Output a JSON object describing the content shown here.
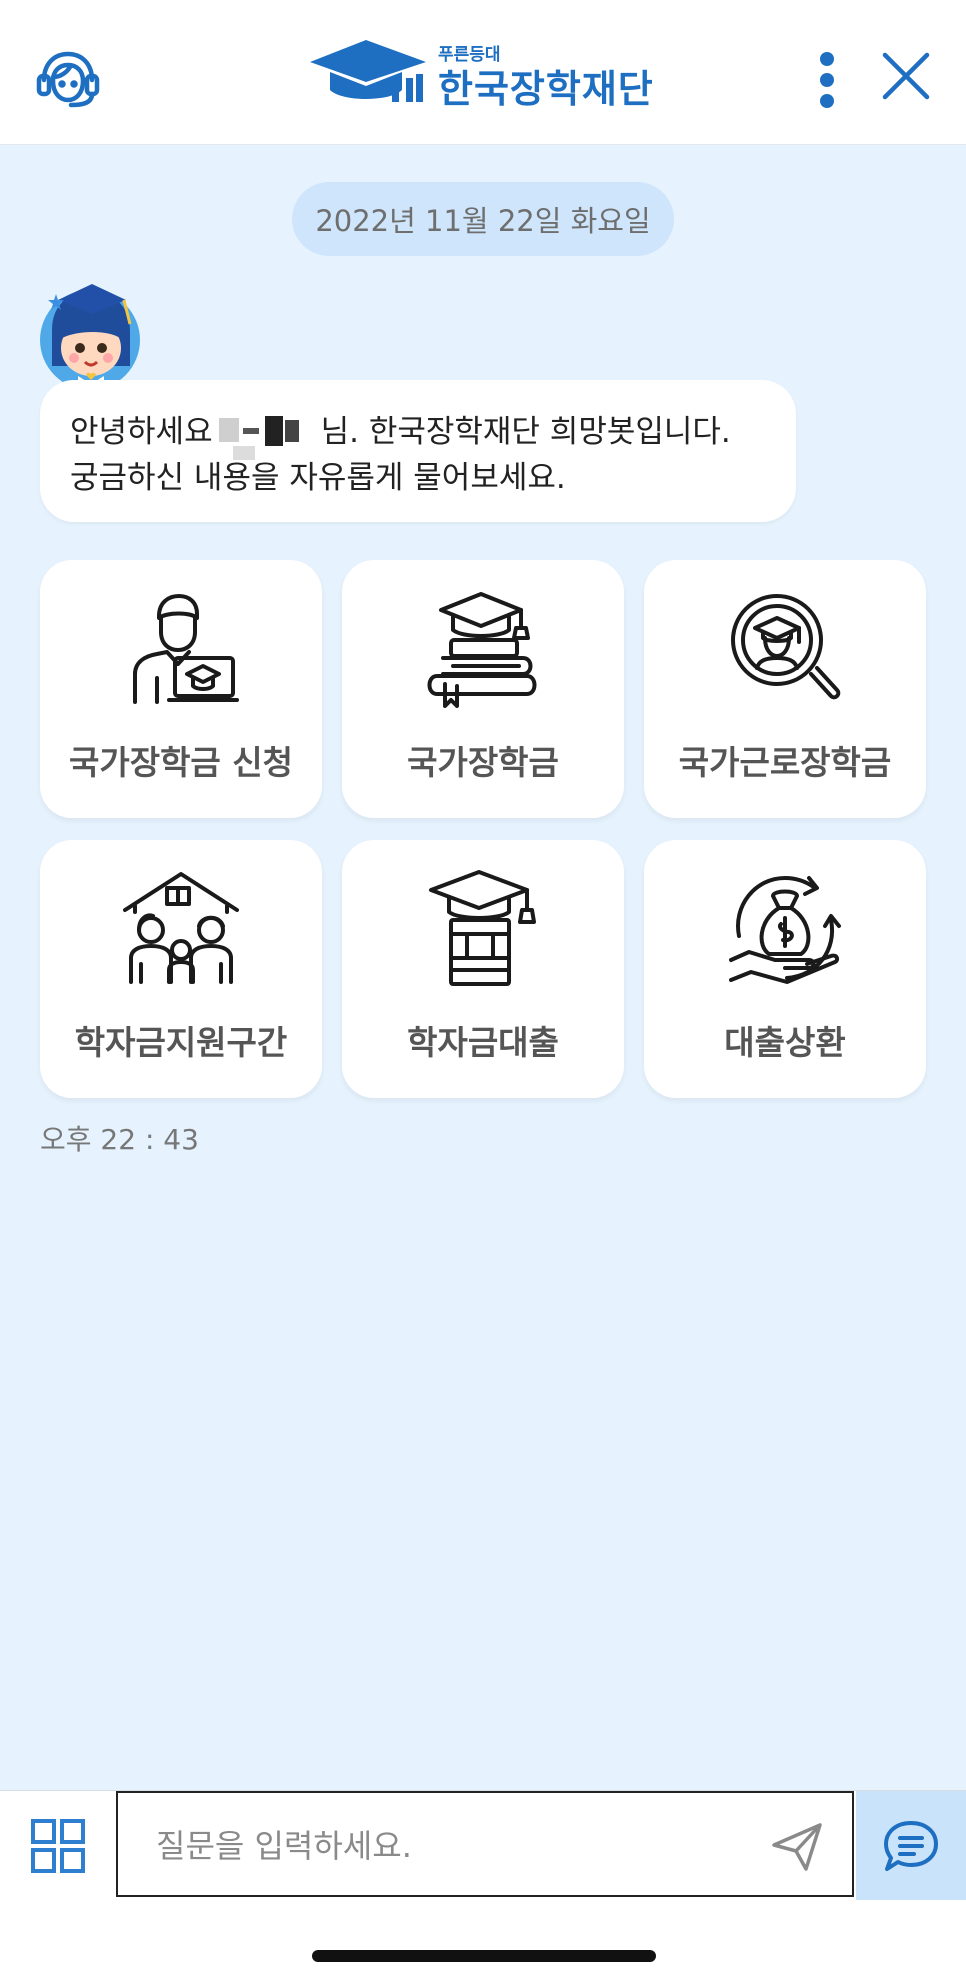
{
  "header": {
    "logo_sub": "푸른등대",
    "logo_main": "한국장학재단",
    "brand_color": "#1e6fc1",
    "left_icon": "headset-agent-icon",
    "more_icon": "more-vertical-icon",
    "close_icon": "close-icon"
  },
  "date_label": "2022년 11월 22일 화요일",
  "greeting": {
    "line1_a": "안녕하세요",
    "line1_b": "님. 한국장학재단 희망봇입니다.",
    "line2": "궁금하신 내용을 자유롭게 물어보세요."
  },
  "menu_tiles": [
    {
      "label": "국가장학금 신청",
      "icon": "student-laptop-icon"
    },
    {
      "label": "국가장학금",
      "icon": "books-graduation-cap-icon"
    },
    {
      "label": "국가근로장학금",
      "icon": "magnifier-graduate-icon"
    },
    {
      "label": "학자금지원구간",
      "icon": "family-house-icon"
    },
    {
      "label": "학자금대출",
      "icon": "graduation-cap-money-icon"
    },
    {
      "label": "대출상환",
      "icon": "money-bag-cycle-icon"
    }
  ],
  "timestamp": "오후 22 : 43",
  "input": {
    "placeholder": "질문을 입력하세요.",
    "value": ""
  },
  "bottom_icons": {
    "menu": "grid-menu-icon",
    "send": "send-icon",
    "chat": "chat-bubble-icon"
  }
}
